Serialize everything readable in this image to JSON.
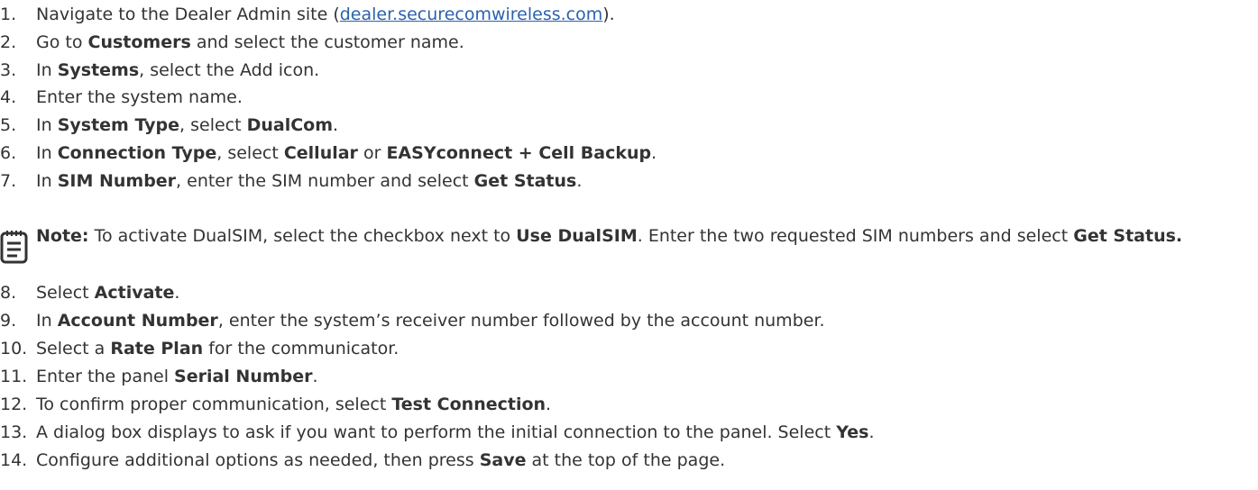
{
  "steps": [
    {
      "num": "1.",
      "parts": [
        "Navigate to the Dealer Admin site (",
        "dealer.securecomwireless.com",
        ")."
      ]
    },
    {
      "num": "2.",
      "parts": [
        "Go to ",
        "Customers",
        " and select the customer name."
      ]
    },
    {
      "num": "3.",
      "parts": [
        "In ",
        "Systems",
        ", select the Add icon."
      ]
    },
    {
      "num": "4.",
      "parts": [
        "Enter the system name."
      ]
    },
    {
      "num": "5.",
      "parts": [
        "In ",
        "System Type",
        ", select ",
        "DualCom",
        "."
      ]
    },
    {
      "num": "6.",
      "parts": [
        "In ",
        "Connection Type",
        ", select ",
        "Cellular",
        " or ",
        "EASYconnect + Cell Backup",
        "."
      ]
    },
    {
      "num": "7.",
      "parts": [
        "In ",
        "SIM Number",
        ", enter the SIM number and select ",
        "Get Status",
        "."
      ]
    },
    {
      "num": "8.",
      "parts": [
        "Select ",
        "Activate",
        "."
      ]
    },
    {
      "num": "9.",
      "parts": [
        "In ",
        "Account Number",
        ", enter the system’s receiver number followed by the account number."
      ]
    },
    {
      "num": "10.",
      "parts": [
        "Select a ",
        "Rate Plan",
        " for the communicator."
      ]
    },
    {
      "num": "11.",
      "parts": [
        "Enter the panel ",
        "Serial Number",
        "."
      ]
    },
    {
      "num": "12.",
      "parts": [
        "To confirm proper communication, select ",
        "Test Connection",
        "."
      ]
    },
    {
      "num": "13.",
      "parts": [
        "A dialog box displays to ask if you want to perform the initial connection to the panel. Select ",
        "Yes",
        "."
      ]
    },
    {
      "num": "14.",
      "parts": [
        "Configure additional options as needed, then press ",
        "Save",
        " at the top of the page."
      ]
    }
  ],
  "note": {
    "label": "Note:",
    "parts": [
      " To activate DualSIM, select the checkbox next to ",
      "Use DualSIM",
      ". Enter the two requested SIM numbers and select ",
      "Get Status."
    ]
  },
  "icons": {
    "note": "note-pad-icon"
  },
  "colors": {
    "text": "#333333",
    "link": "#2b62ad"
  }
}
